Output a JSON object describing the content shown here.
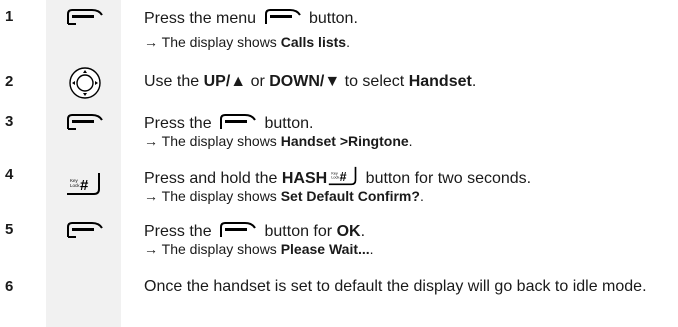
{
  "steps": [
    {
      "num": "1",
      "line1_a": "Press the menu",
      "line1_b": "button.",
      "line2_arrow": "→",
      "line2_a": "The display shows",
      "line2_b": "Calls lists",
      "line2_c": "."
    },
    {
      "num": "2",
      "a": "Use the",
      "b": "UP/▲",
      "c": "or",
      "d": "DOWN/▼",
      "e": "to select",
      "f": "Handset",
      "g": "."
    },
    {
      "num": "3",
      "line1_a": "Press the",
      "line1_b": "button.",
      "line2_arrow": "→",
      "line2_a": "The display shows",
      "line2_b": "Handset >Ringtone",
      "line2_c": "."
    },
    {
      "num": "4",
      "line1_a": "Press and hold the",
      "line1_b": "HASH",
      "line1_c": "button for two seconds.",
      "line2_arrow": "→",
      "line2_a": "The display shows",
      "line2_b": "Set Default Confirm?",
      "line2_c": "."
    },
    {
      "num": "5",
      "line1_a": "Press the",
      "line1_b": "button for",
      "line1_c": "OK",
      "line1_d": ".",
      "line2_arrow": "→",
      "line2_a": "The display shows",
      "line2_b": "Please Wait...",
      "line2_c": "."
    },
    {
      "num": "6",
      "text": "Once the handset is set to default the display will go back to idle mode."
    }
  ],
  "hash_key": {
    "label_top": "Key",
    "label_bottom": "Lock",
    "symbol": "#"
  },
  "icons": {
    "menu": "menu-key-icon",
    "nav": "navigation-key-icon",
    "hash": "hash-key-icon"
  }
}
